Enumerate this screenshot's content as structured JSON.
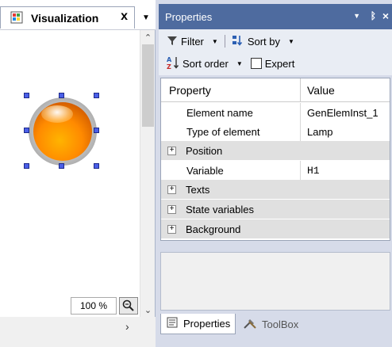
{
  "editor": {
    "tab_title": "Visualization",
    "tab_close": "x",
    "zoom_value": "100 %",
    "element_icon": "lamp-element",
    "colors": {
      "lamp_main": "#ff8a00",
      "selection_handle": "#4a5fe8"
    }
  },
  "properties_panel": {
    "title": "Properties",
    "toolbar": {
      "filter_label": "Filter",
      "sort_by_label": "Sort by",
      "sort_order_label": "Sort order",
      "expert_label": "Expert",
      "expert_checked": false
    },
    "columns": {
      "property": "Property",
      "value": "Value"
    },
    "rows": [
      {
        "type": "leaf",
        "name": "Element name",
        "value": "GenElemInst_1"
      },
      {
        "type": "leaf",
        "name": "Type of element",
        "value": "Lamp"
      },
      {
        "type": "group",
        "name": "Position",
        "expander": "+"
      },
      {
        "type": "leaf",
        "name": "Variable",
        "value": "H1"
      },
      {
        "type": "group",
        "name": "Texts",
        "expander": "+"
      },
      {
        "type": "group",
        "name": "State variables",
        "expander": "+"
      },
      {
        "type": "group",
        "name": "Background",
        "expander": "+"
      }
    ],
    "bottom_tabs": [
      {
        "label": "Properties",
        "active": true
      },
      {
        "label": "ToolBox",
        "active": false
      }
    ],
    "colors": {
      "titlebar": "#4e6b9f",
      "group_row": "#e0e0e0"
    }
  }
}
